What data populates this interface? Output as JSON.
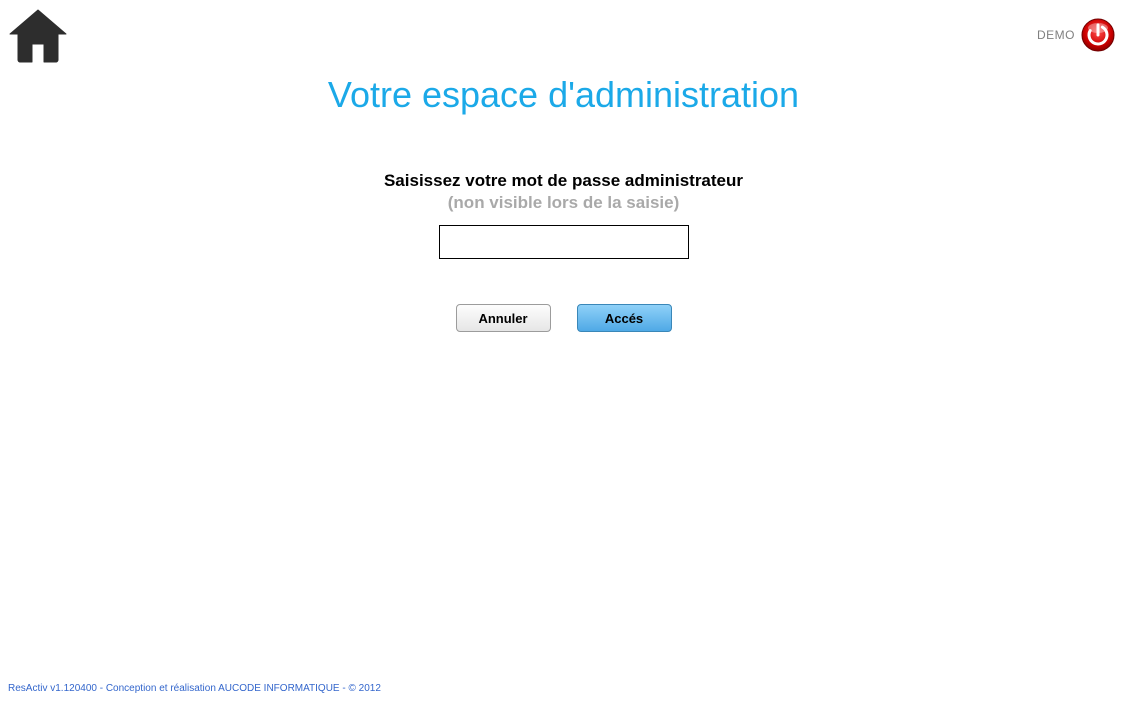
{
  "header": {
    "demo_label": "DEMO"
  },
  "main": {
    "title": "Votre espace d'administration",
    "prompt": "Saisissez votre mot de passe administrateur",
    "hint": "(non visible lors de la saisie)",
    "password_value": "",
    "cancel_label": "Annuler",
    "access_label": "Accés"
  },
  "footer": {
    "text": "ResActiv v1.120400 - Conception et réalisation AUCODE INFORMATIQUE - © 2012"
  },
  "colors": {
    "title": "#1ba9e8",
    "link": "#3366cc",
    "power": "#cc0000"
  }
}
